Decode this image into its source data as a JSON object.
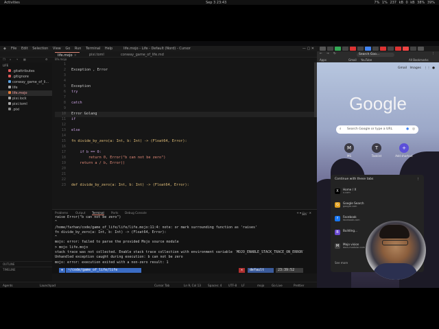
{
  "os_bar": {
    "activities": "Activities",
    "clock": "Sep 3 23:43",
    "status": "7%  1%  237 kB  0 kB  38%  39%"
  },
  "editor": {
    "title": "life.mojo - Life - Default (Nord) - Cursor",
    "menu": [
      "File",
      "Edit",
      "Selection",
      "View",
      "Go",
      "Run",
      "Terminal",
      "Help"
    ],
    "tabs": [
      {
        "label": "life.mojo",
        "active": true
      },
      {
        "label": "pixi.toml",
        "active": false
      },
      {
        "label": "conway_game_of_life.md",
        "active": false
      }
    ],
    "breadcrumb": "life.mojo",
    "explorer_header": "LIFE",
    "files": [
      {
        "name": ".gitattributes",
        "color": "#e05a5a",
        "selected": false
      },
      {
        "name": ".gitignore",
        "color": "#e05a5a",
        "selected": false
      },
      {
        "name": "conway_game_of_li...",
        "color": "#5aa0e0",
        "selected": false
      },
      {
        "name": "life",
        "color": "#aaaaaa",
        "selected": false
      },
      {
        "name": "life.mojo",
        "color": "#e07a3a",
        "selected": true
      },
      {
        "name": "pixi.lock",
        "color": "#aaaaaa",
        "selected": false
      },
      {
        "name": "pixi.toml",
        "color": "#aaaaaa",
        "selected": false
      },
      {
        "name": ".pixi",
        "color": "#888888",
        "selected": false
      }
    ],
    "outline": "OUTLINE",
    "timeline": "TIMELINE",
    "agents": "Agents"
  },
  "code_lines": [
    {
      "n": "1",
      "text": ""
    },
    {
      "n": "2",
      "text": "Exception , Error"
    },
    {
      "n": "3",
      "text": ""
    },
    {
      "n": "4",
      "text": ""
    },
    {
      "n": "5",
      "text": "Exception"
    },
    {
      "n": "6",
      "text": "try"
    },
    {
      "n": "7",
      "text": ""
    },
    {
      "n": "8",
      "text": "catch"
    },
    {
      "n": "9",
      "text": ""
    },
    {
      "n": "10",
      "text": "Error Golang"
    },
    {
      "n": "11",
      "text": "if"
    },
    {
      "n": "12",
      "text": ""
    },
    {
      "n": "13",
      "text": "else"
    },
    {
      "n": "14",
      "text": ""
    },
    {
      "n": "15",
      "text": "fn divide_by_zero(a: Int, b: Int) -> (Float64, Error):"
    },
    {
      "n": "16",
      "text": ""
    },
    {
      "n": "17",
      "text": "    if b == 0:"
    },
    {
      "n": "18",
      "text": "        return 0, Error(\"b can not be zero\")"
    },
    {
      "n": "19",
      "text": "    return a / b, Error()"
    },
    {
      "n": "20",
      "text": ""
    },
    {
      "n": "21",
      "text": ""
    },
    {
      "n": "22",
      "text": ""
    },
    {
      "n": "23",
      "text": "def divide_by_zero(a: Int, b: Int) -> (Float64, Error):"
    }
  ],
  "panel": {
    "tabs": [
      "Problems",
      "Output",
      "Terminal",
      "Ports",
      "Debug Console"
    ],
    "active_tab": "Terminal",
    "shell": "zsh",
    "terminal_lines": [
      "    raise Error(\"b can not be zero\")",
      "    ^",
      "/home/farhan/code/game_of_life/life/life.mojo:11:4: note: or mark surrounding function as 'raises'",
      "fn divide_by_zero(a: Int, b: Int) -> (Float64, Error):",
      "   ^",
      "mojo: error: failed to parse the provided Mojo source module",
      "> mojo life.mojo",
      "stack trace was not collected. Enable stack trace collection with environment variable `MOJO_ENABLE_STACK_TRACE_ON_ERROR`",
      "Unhandled exception caught during execution: b can not be zero",
      "mojo: error: execution exited with a non-zero result: 1"
    ],
    "prompt_path": "~/code/game_of_life/life",
    "prompt_env": "default",
    "prompt_time": "23:39:52"
  },
  "statusbar": {
    "launchpad": "Launchpad",
    "cursor_tab": "Cursor Tab",
    "position": "Ln 9, Col 13",
    "spaces": "Spaces: 4",
    "encoding": "UTF-8",
    "eol": "LF",
    "lang": "mojo",
    "golive": "Go Live",
    "prettier": "Prettier"
  },
  "browser": {
    "omnibox": "Search Goo...",
    "bookmarks": [
      "Apps",
      "Gmail",
      "YouTube",
      "All Bookmarks"
    ],
    "links": [
      "Gmail",
      "Images"
    ],
    "logo": "Google",
    "search_placeholder": "Search Google or type a URL",
    "shortcuts": [
      {
        "label": "MS",
        "glyph": "M"
      },
      {
        "label": "Tasklist",
        "glyph": "T"
      },
      {
        "label": "Add shortcut",
        "glyph": "+"
      }
    ],
    "continue_header": "Continue with these tabs",
    "continue_items": [
      {
        "title": "Home / X",
        "sub": "x.com",
        "color": "#000000",
        "glyph": "X"
      },
      {
        "title": "Google Search",
        "sub": "google.com",
        "color": "#e0a020",
        "glyph": "G"
      },
      {
        "title": "Facebook",
        "sub": "facebook.com",
        "color": "#1877f2",
        "glyph": "f"
      },
      {
        "title": "Building...",
        "sub": "",
        "color": "#6a4ad0",
        "glyph": "B"
      },
      {
        "title": "Mojo vision",
        "sub": "docs.modular.com",
        "color": "#444444",
        "glyph": "M"
      }
    ],
    "see_more": "See more"
  }
}
